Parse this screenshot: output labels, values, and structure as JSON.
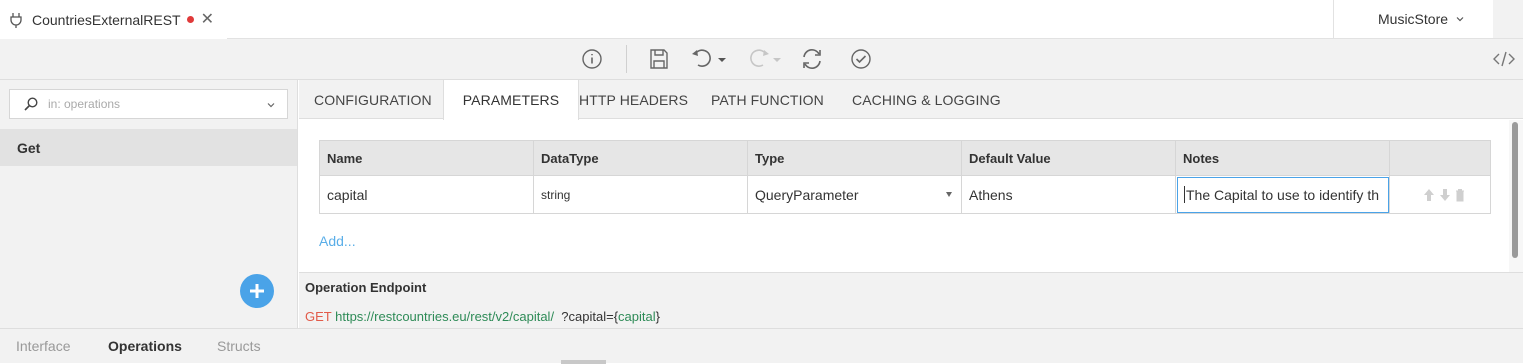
{
  "document_tab": {
    "title": "CountriesExternalREST",
    "modified": true,
    "icon": "plug-icon"
  },
  "project": {
    "name": "MusicStore"
  },
  "toolbar": {
    "icons": [
      "info-icon",
      "save-icon",
      "undo-icon",
      "redo-icon",
      "refresh-icon",
      "validate-icon",
      "code-view-icon"
    ]
  },
  "search": {
    "placeholder": "in: operations"
  },
  "operations": [
    {
      "label": "Get",
      "selected": true
    }
  ],
  "tabs": [
    {
      "label": "CONFIGURATION",
      "active": false
    },
    {
      "label": "PARAMETERS",
      "active": true
    },
    {
      "label": "HTTP HEADERS",
      "active": false
    },
    {
      "label": "PATH FUNCTION",
      "active": false
    },
    {
      "label": "CACHING & LOGGING",
      "active": false
    }
  ],
  "params_table": {
    "columns": [
      "Name",
      "DataType",
      "Type",
      "Default Value",
      "Notes"
    ],
    "rows": [
      {
        "name": "capital",
        "datatype": "string",
        "type": "QueryParameter",
        "default_value": "Athens",
        "notes": "The Capital to use to identify th"
      }
    ]
  },
  "add_link": "Add...",
  "endpoint": {
    "label": "Operation Endpoint",
    "method": "GET",
    "url": "https://restcountries.eu/rest/v2/capital/",
    "query_prefix": "?capital={",
    "query_param": "capital",
    "query_suffix": "}"
  },
  "bottom_tabs": [
    {
      "label": "Interface",
      "active": false
    },
    {
      "label": "Operations",
      "active": true
    },
    {
      "label": "Structs",
      "active": false
    }
  ],
  "colors": {
    "accent": "#4aa3e8",
    "method": "#e25b4a",
    "url": "#2e8b57",
    "modified_dot": "#e03a3a"
  }
}
